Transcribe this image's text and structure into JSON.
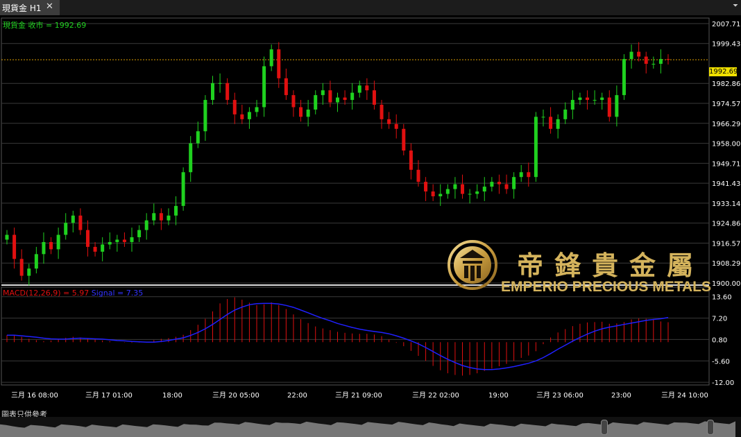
{
  "window": {
    "tab_title": "現貨金 H1",
    "close_glyph": "✕",
    "menu_glyph": "⏷"
  },
  "main_panel": {
    "price_label": "現貨金 收市 = 1992.69",
    "current_price": "1992.69"
  },
  "macd_panel": {
    "label": "MACD(12,26,9) = 5.97",
    "signal_label": "Signal = 7.35"
  },
  "footer": {
    "note": "圖表只供參考"
  },
  "watermark": {
    "chinese": "帝鋒貴金屬",
    "english": "EMPERIO PRECIOUS METALS"
  },
  "colors": {
    "background": "#000000",
    "grid": "#3a3a3a",
    "bull": "#1fd11f",
    "bear": "#e01010",
    "macd_hist": "#e01010",
    "signal": "#2020ff",
    "current_price_line": "#e0a000",
    "axis_text": "#ffffff"
  },
  "chart_data": [
    {
      "type": "candlestick",
      "title": "現貨金 H1",
      "y_ticks": [
        "2007.71",
        "1999.43",
        "1982.86",
        "1974.57",
        "1966.29",
        "1958.00",
        "1949.71",
        "1941.43",
        "1933.14",
        "1924.86",
        "1916.57",
        "1908.29",
        "1900.00"
      ],
      "ylim": [
        1900.0,
        2010.0
      ],
      "current_price": 1992.69,
      "x_ticks": [
        "三月 16 08:00",
        "三月 17 01:00",
        "18:00",
        "三月 20 05:00",
        "22:00",
        "三月 21 09:00",
        "三月 22 02:00",
        "19:00",
        "三月 23 06:00",
        "23:00",
        "三月 24 10:00"
      ],
      "close_series": [
        1920,
        1910,
        1903,
        1906,
        1912,
        1917,
        1914,
        1920,
        1925,
        1928,
        1922,
        1915,
        1913,
        1916,
        1917,
        1918,
        1917,
        1919,
        1922,
        1926,
        1929,
        1926,
        1928,
        1932,
        1946,
        1958,
        1963,
        1976,
        1983,
        1983,
        1976,
        1970,
        1968,
        1971,
        1973,
        1990,
        1997,
        1985,
        1978,
        1973,
        1969,
        1972,
        1978,
        1980,
        1975,
        1977,
        1976,
        1979,
        1982,
        1980,
        1974,
        1968,
        1966,
        1964,
        1955,
        1947,
        1942,
        1938,
        1936,
        1937,
        1939,
        1941,
        1937,
        1937,
        1938,
        1940,
        1942,
        1941,
        1939,
        1944,
        1946,
        1944,
        1969,
        1969,
        1964,
        1968,
        1972,
        1976,
        1977,
        1976,
        1976,
        1977,
        1969,
        1978,
        1993,
        1996,
        1994,
        1991,
        1991,
        1993,
        1992.69
      ]
    },
    {
      "type": "bar",
      "title": "MACD(12,26,9)",
      "y_ticks": [
        "13.60",
        "7.20",
        "0.80",
        "-5.60",
        "-12.00"
      ],
      "ylim": [
        -12.8,
        15.2
      ],
      "macd_value": 5.97,
      "signal_value": 7.35,
      "macd_series": [
        2.1,
        2.0,
        1.6,
        1.0,
        0.6,
        0.3,
        0.5,
        0.9,
        1.3,
        1.6,
        1.4,
        1.0,
        0.8,
        0.5,
        0.3,
        0.0,
        -0.1,
        -0.2,
        -0.1,
        0.1,
        0.6,
        1.0,
        1.2,
        1.6,
        2.2,
        3.6,
        5.2,
        7.0,
        9.2,
        11.6,
        12.9,
        13.4,
        12.7,
        11.8,
        11.1,
        11.3,
        11.9,
        11.1,
        9.9,
        8.3,
        6.9,
        5.7,
        4.7,
        4.1,
        3.6,
        3.1,
        2.8,
        2.6,
        2.5,
        2.5,
        2.3,
        1.8,
        0.8,
        -0.2,
        -1.2,
        -2.6,
        -4.1,
        -5.6,
        -7.1,
        -8.4,
        -9.3,
        -9.8,
        -10.0,
        -9.8,
        -9.3,
        -8.6,
        -7.9,
        -7.2,
        -6.5,
        -5.6,
        -4.7,
        -4.0,
        -2.7,
        -0.6,
        1.4,
        2.9,
        3.9,
        4.8,
        5.5,
        5.9,
        6.0,
        6.1,
        5.5,
        5.6,
        6.0,
        6.8,
        7.1,
        7.0,
        6.7,
        6.2,
        5.97
      ],
      "signal_series": [
        2.1,
        2.1,
        1.9,
        1.7,
        1.5,
        1.2,
        1.0,
        0.9,
        0.9,
        1.1,
        1.2,
        1.1,
        1.0,
        0.9,
        0.7,
        0.5,
        0.4,
        0.2,
        0.1,
        0.0,
        0.0,
        0.2,
        0.5,
        0.9,
        1.3,
        2.0,
        2.9,
        4.0,
        5.3,
        6.8,
        8.3,
        9.6,
        10.5,
        11.2,
        11.5,
        11.6,
        11.6,
        11.4,
        11.0,
        10.4,
        9.6,
        8.8,
        7.9,
        7.1,
        6.4,
        5.6,
        5.0,
        4.4,
        3.9,
        3.5,
        3.2,
        2.9,
        2.5,
        1.9,
        1.2,
        0.4,
        -0.5,
        -1.6,
        -2.8,
        -4.0,
        -5.1,
        -6.1,
        -7.0,
        -7.6,
        -8.0,
        -8.2,
        -8.2,
        -8.0,
        -7.7,
        -7.3,
        -6.8,
        -6.3,
        -5.6,
        -4.6,
        -3.4,
        -2.1,
        -0.9,
        0.3,
        1.4,
        2.4,
        3.3,
        4.0,
        4.5,
        4.9,
        5.3,
        5.7,
        6.1,
        6.5,
        6.8,
        7.0,
        7.35
      ]
    }
  ]
}
